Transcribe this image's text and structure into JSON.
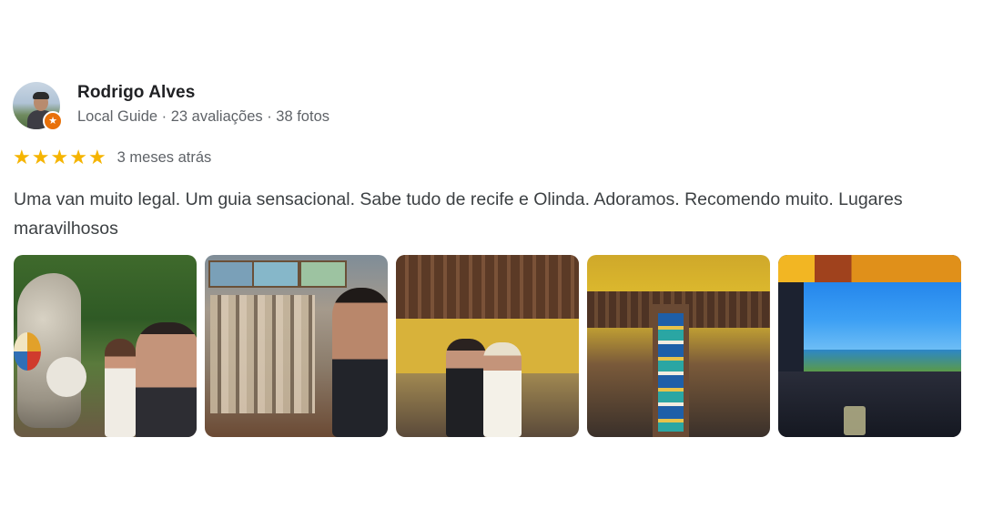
{
  "reviewer": {
    "name": "Rodrigo Alves",
    "meta": "Local Guide · 23 avaliações · 38 fotos",
    "badge_icon": "local-guide-star-icon",
    "badge_color": "#e8710a"
  },
  "rating": {
    "stars": "★★★★★",
    "star_color": "#f5b400",
    "date": "3 meses atrás"
  },
  "review_text": "Uma van muito legal. Um guia sensacional. Sabe tudo de recife e Olinda. Adoramos. Recomendo muito. Lugares maravilhosos",
  "photos": [
    {
      "kind": "photo-thumbnail"
    },
    {
      "kind": "photo-thumbnail"
    },
    {
      "kind": "photo-thumbnail"
    },
    {
      "kind": "photo-thumbnail"
    },
    {
      "kind": "photo-thumbnail"
    }
  ]
}
